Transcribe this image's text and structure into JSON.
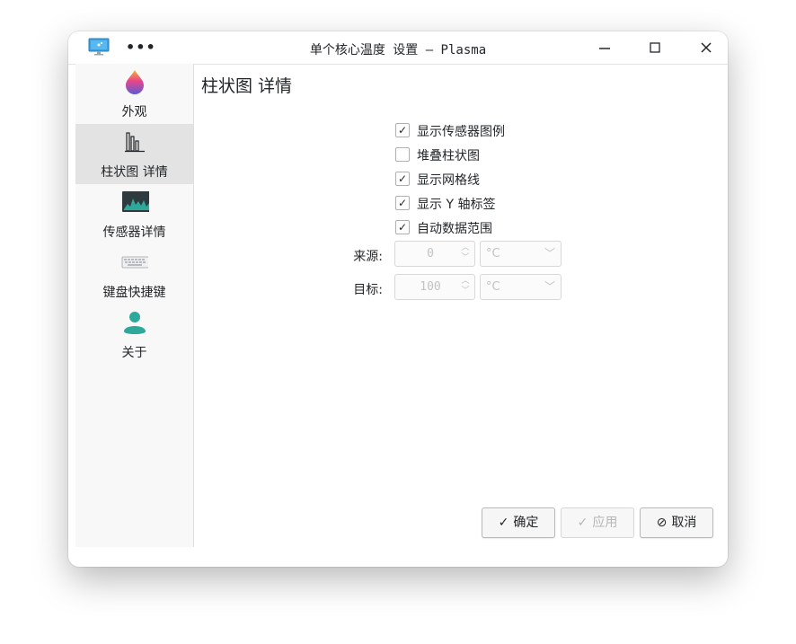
{
  "window": {
    "title": "单个核心温度 设置 — Plasma",
    "more_label": "•••",
    "minimize_icon": "minimize-icon",
    "maximize_icon": "maximize-icon",
    "close_icon": "close-icon"
  },
  "sidebar": {
    "items": [
      {
        "label": "外观",
        "icon": "appearance-drop-icon"
      },
      {
        "label": "柱状图 详情",
        "icon": "bar-chart-icon"
      },
      {
        "label": "传感器详情",
        "icon": "sensor-monitor-icon"
      },
      {
        "label": "键盘快捷键",
        "icon": "keyboard-icon"
      },
      {
        "label": "关于",
        "icon": "user-icon"
      }
    ],
    "active_index": 1
  },
  "main": {
    "title": "柱状图 详情",
    "options": [
      {
        "label": "显示传感器图例",
        "checked": true
      },
      {
        "label": "堆叠柱状图",
        "checked": false
      },
      {
        "label": "显示网格线",
        "checked": true
      },
      {
        "label": "显示 Y 轴标签",
        "checked": true
      },
      {
        "label": "自动数据范围",
        "checked": true
      }
    ],
    "from": {
      "label": "来源:",
      "value": "0",
      "unit": "°C"
    },
    "to": {
      "label": "目标:",
      "value": "100",
      "unit": "°C"
    }
  },
  "buttons": {
    "ok": "确定",
    "apply": "应用",
    "cancel": "取消"
  },
  "colors": {
    "active_item": "#e3e3e3",
    "sidebar_bg": "#f8f8f8",
    "accent_teal": "#2ea89a"
  }
}
